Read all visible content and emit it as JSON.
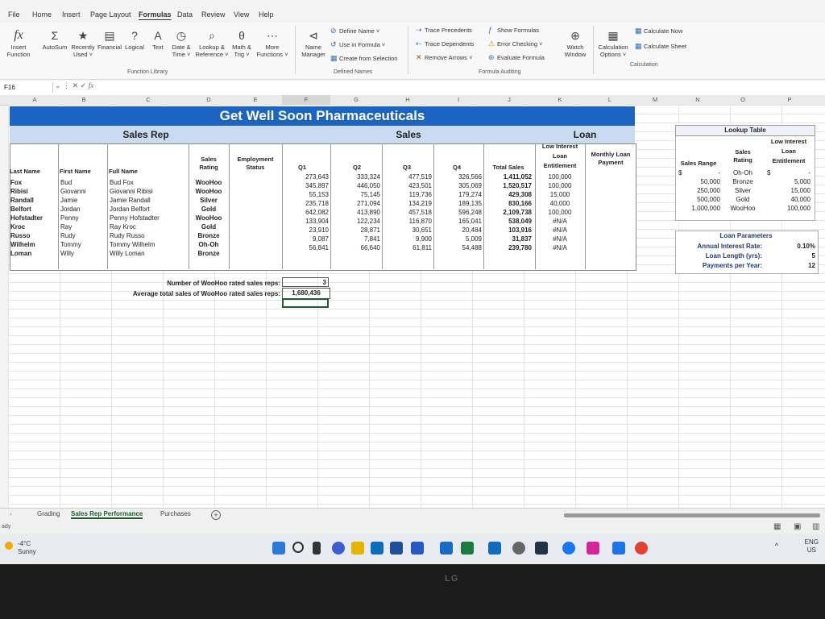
{
  "menu": [
    "File",
    "Home",
    "Insert",
    "Page Layout",
    "Formulas",
    "Data",
    "Review",
    "View",
    "Help"
  ],
  "menu_active": "Formulas",
  "ribbon": {
    "insert_function": "Insert\nFunction",
    "autosum": "AutoSum",
    "recently_used": "Recently\nUsed ˅",
    "financial": "Financial",
    "logical": "Logical",
    "text": "Text",
    "date_time": "Date &\nTime ˅",
    "lookup": "Lookup &\nReference ˅",
    "math": "Math &\nTrig ˅",
    "more": "More\nFunctions ˅",
    "group_function_library": "Function Library",
    "name_manager": "Name\nManager",
    "define_name": "Define Name ˅",
    "use_in_formula": "Use in Formula ˅",
    "create_from_selection": "Create from Selection",
    "group_defined_names": "Defined Names",
    "trace_precedents": "Trace Precedents",
    "trace_dependents": "Trace Dependents",
    "remove_arrows": "Remove Arrows ˅",
    "show_formulas": "Show Formulas",
    "error_checking": "Error Checking ˅",
    "evaluate_formula": "Evaluate Formula",
    "watch_window": "Watch\nWindow",
    "group_formula_auditing": "Formula Auditing",
    "calc_options": "Calculation\nOptions ˅",
    "calc_now": "Calculate Now",
    "calc_sheet": "Calculate Sheet",
    "group_calculation": "Calculation"
  },
  "formula_bar": {
    "name_box": "F16",
    "fx": "fx"
  },
  "columns": [
    "A",
    "B",
    "C",
    "D",
    "E",
    "F",
    "G",
    "H",
    "I",
    "J",
    "K",
    "L",
    "M",
    "N",
    "O",
    "P"
  ],
  "sheet": {
    "title": "Get Well Soon Pharmaceuticals",
    "sec_sales_rep": "Sales Rep",
    "sec_sales": "Sales",
    "sec_loan": "Loan",
    "headers": {
      "last": "Last Name",
      "first": "First Name",
      "full": "Full Name",
      "rating": "Sales\nRating",
      "employment": "Employment\nStatus",
      "q1": "Q1",
      "q2": "Q2",
      "q3": "Q3",
      "q4": "Q4",
      "total": "Total Sales",
      "low": "Low Interest\nLoan\nEntitlement",
      "monthly": "Monthly Loan\nPayment"
    },
    "rows": [
      {
        "last": "Fox",
        "first": "Bud",
        "full": "Bud Fox",
        "rating": "WooHoo",
        "q1": "273,643",
        "q2": "333,324",
        "q3": "477,519",
        "q4": "326,566",
        "total": "1,411,052",
        "loan": "100,000"
      },
      {
        "last": "Ribisi",
        "first": "Giovanni",
        "full": "Giovanni Ribisi",
        "rating": "WooHoo",
        "q1": "345,897",
        "q2": "446,050",
        "q3": "423,501",
        "q4": "305,069",
        "total": "1,520,517",
        "loan": "100,000"
      },
      {
        "last": "Randall",
        "first": "Jamie",
        "full": "Jamie Randall",
        "rating": "Silver",
        "q1": "55,153",
        "q2": "75,145",
        "q3": "119,736",
        "q4": "179,274",
        "total": "429,308",
        "loan": "15,000"
      },
      {
        "last": "Belfort",
        "first": "Jordan",
        "full": "Jordan Belfort",
        "rating": "Gold",
        "q1": "235,718",
        "q2": "271,094",
        "q3": "134,219",
        "q4": "189,135",
        "total": "830,166",
        "loan": "40,000"
      },
      {
        "last": "Hofstadter",
        "first": "Penny",
        "full": "Penny Hofstadter",
        "rating": "WooHoo",
        "q1": "642,082",
        "q2": "413,890",
        "q3": "457,518",
        "q4": "596,248",
        "total": "2,109,738",
        "loan": "100,000"
      },
      {
        "last": "Kroc",
        "first": "Ray",
        "full": "Ray Kroc",
        "rating": "Gold",
        "q1": "133,904",
        "q2": "122,234",
        "q3": "116,870",
        "q4": "165,041",
        "total": "538,049",
        "loan": "#N/A"
      },
      {
        "last": "Russo",
        "first": "Rudy",
        "full": "Rudy Russo",
        "rating": "Bronze",
        "q1": "23,910",
        "q2": "28,871",
        "q3": "30,651",
        "q4": "20,484",
        "total": "103,916",
        "loan": "#N/A"
      },
      {
        "last": "Wilhelm",
        "first": "Tommy",
        "full": "Tommy Wilhelm",
        "rating": "Oh-Oh",
        "q1": "9,087",
        "q2": "7,841",
        "q3": "9,900",
        "q4": "5,009",
        "total": "31,837",
        "loan": "#N/A"
      },
      {
        "last": "Loman",
        "first": "Willy",
        "full": "Willy Loman",
        "rating": "Bronze",
        "q1": "56,841",
        "q2": "66,640",
        "q3": "61,811",
        "q4": "54,488",
        "total": "239,780",
        "loan": "#N/A"
      }
    ],
    "summary": [
      {
        "label": "Number of WooHoo rated sales reps:",
        "value": "3"
      },
      {
        "label": "Average total sales of WooHoo rated sales reps:",
        "value": "1,680,436"
      }
    ]
  },
  "lookup": {
    "title": "Lookup Table",
    "h_range": "Sales Range",
    "h_rating": "Sales\nRating",
    "h_ent": "Low Interest\nLoan\nEntitlement",
    "rows": [
      {
        "cur": "$",
        "range": "-",
        "rating": "Oh-Oh",
        "cur2": "$",
        "ent": "-"
      },
      {
        "cur": "",
        "range": "50,000",
        "rating": "Bronze",
        "cur2": "",
        "ent": "5,000"
      },
      {
        "cur": "",
        "range": "250,000",
        "rating": "Silver",
        "cur2": "",
        "ent": "15,000"
      },
      {
        "cur": "",
        "range": "500,000",
        "rating": "Gold",
        "cur2": "",
        "ent": "40,000"
      },
      {
        "cur": "",
        "range": "1,000,000",
        "rating": "WooHoo",
        "cur2": "",
        "ent": "100,000"
      }
    ]
  },
  "loan_params": {
    "title": "Loan Parameters",
    "rows": [
      {
        "label": "Annual Interest Rate:",
        "value": "0.10%"
      },
      {
        "label": "Loan Length (yrs):",
        "value": "5"
      },
      {
        "label": "Payments per Year:",
        "value": "12"
      }
    ]
  },
  "tabs": [
    "Grading",
    "Sales Rep Performance",
    "Purchases"
  ],
  "tab_active": "Sales Rep Performance",
  "status": "ady",
  "taskbar": {
    "temp": "-4°C",
    "weather": "Sunny",
    "lang": "ENG",
    "region": "US"
  },
  "bezel_logo": "LG",
  "colors": {
    "title_bg": "#1c64c2",
    "section_bg": "#c9daf2",
    "tab_active": "#1f5c2f"
  }
}
